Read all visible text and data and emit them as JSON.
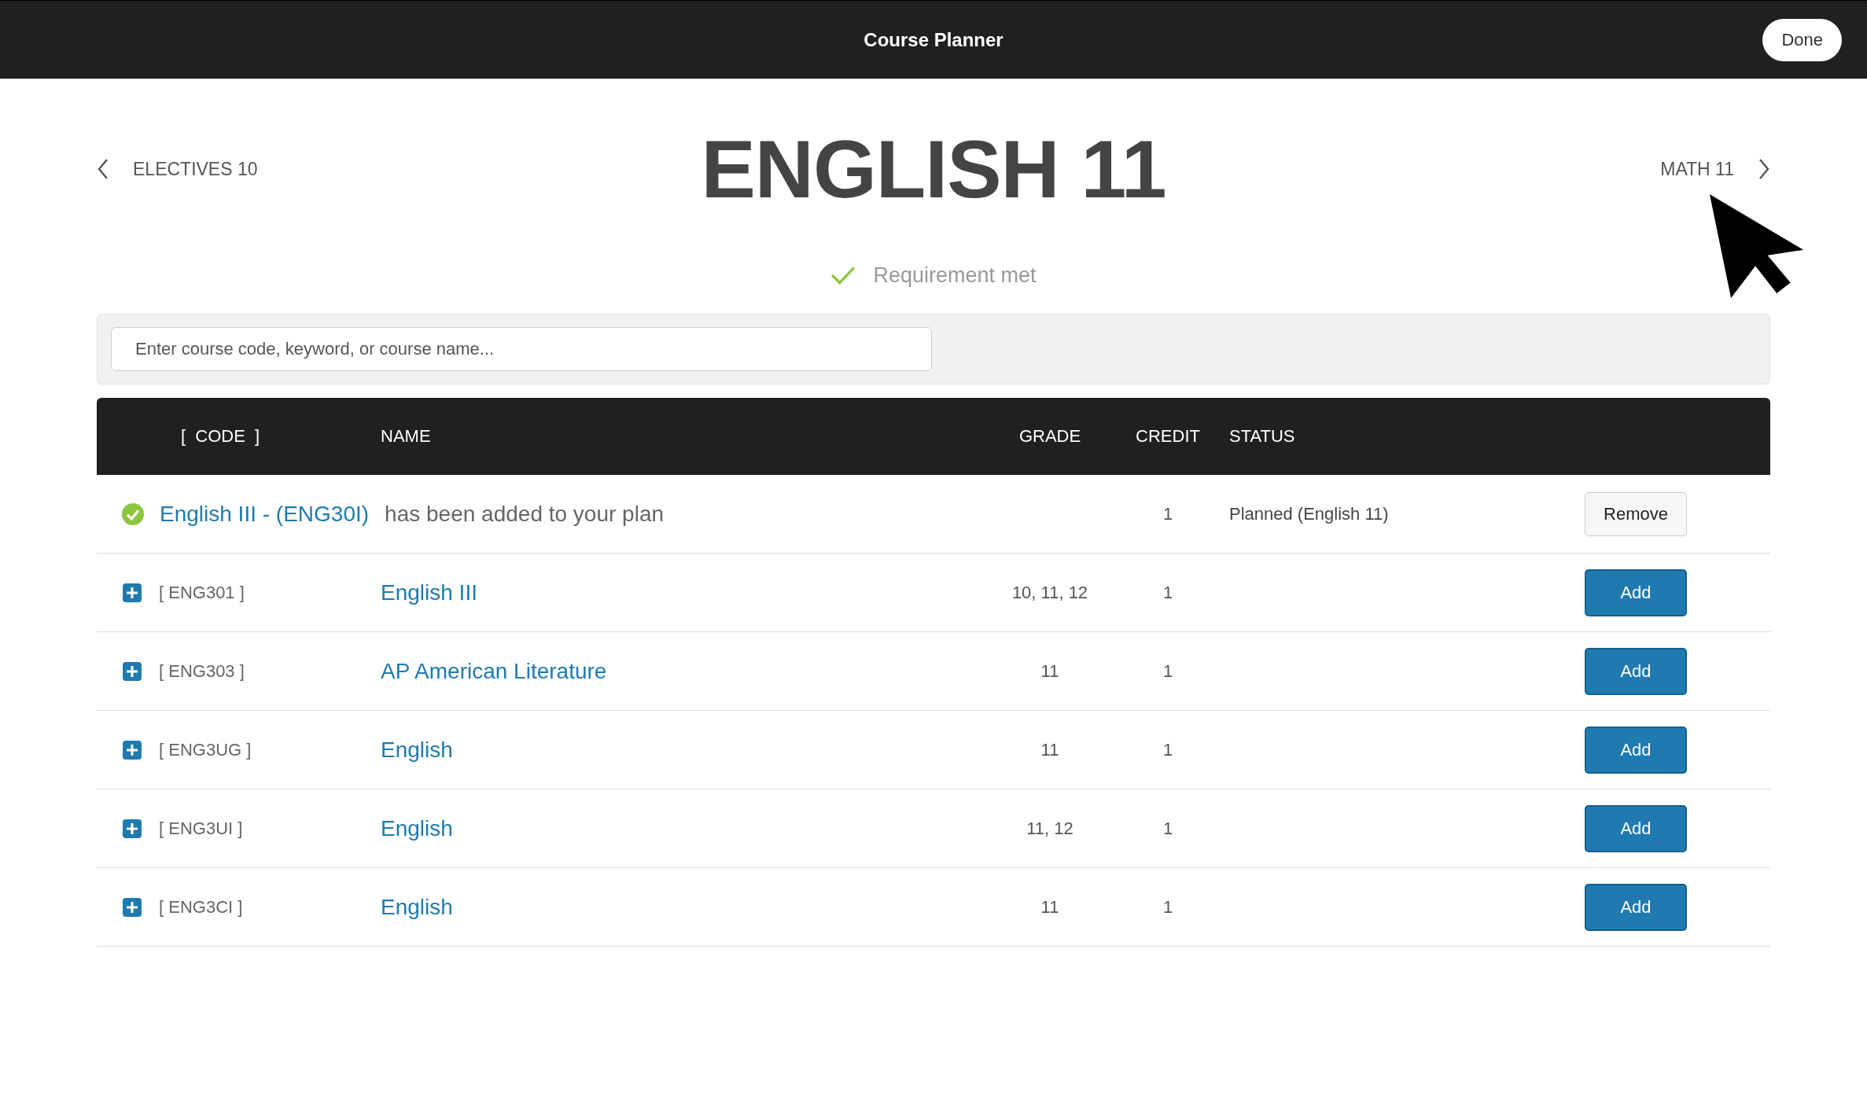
{
  "top_bar": {
    "title": "Course Planner",
    "done_button": "Done"
  },
  "nav": {
    "previous": "ELECTIVES 10",
    "next": "MATH 11"
  },
  "title": "ENGLISH 11",
  "requirement": {
    "text": "Requirement met",
    "met": true
  },
  "search": {
    "placeholder": "Enter course code, keyword, or course name..."
  },
  "table": {
    "columns": [
      "[  CODE  ]",
      "NAME",
      "GRADE",
      "CREDIT",
      "STATUS"
    ],
    "rows": [
      {
        "kind": "added",
        "course_link": "English III - (ENG30I)",
        "message": "has been added to your plan",
        "credit": "1",
        "status": "Planned (English 11)",
        "button": "Remove"
      },
      {
        "kind": "course",
        "code": "[ ENG301 ]",
        "name": "English III",
        "grade": "10, 11, 12",
        "credit": "1",
        "button": "Add"
      },
      {
        "kind": "course",
        "code": "[ ENG303 ]",
        "name": "AP American Literature",
        "grade": "11",
        "credit": "1",
        "button": "Add"
      },
      {
        "kind": "course",
        "code": "[ ENG3UG ]",
        "name": "English",
        "grade": "11",
        "credit": "1",
        "button": "Add"
      },
      {
        "kind": "course",
        "code": "[ ENG3UI ]",
        "name": "English",
        "grade": "11, 12",
        "credit": "1",
        "button": "Add"
      },
      {
        "kind": "course",
        "code": "[ ENG3CI ]",
        "name": "English",
        "grade": "11",
        "credit": "1",
        "button": "Add"
      }
    ]
  }
}
